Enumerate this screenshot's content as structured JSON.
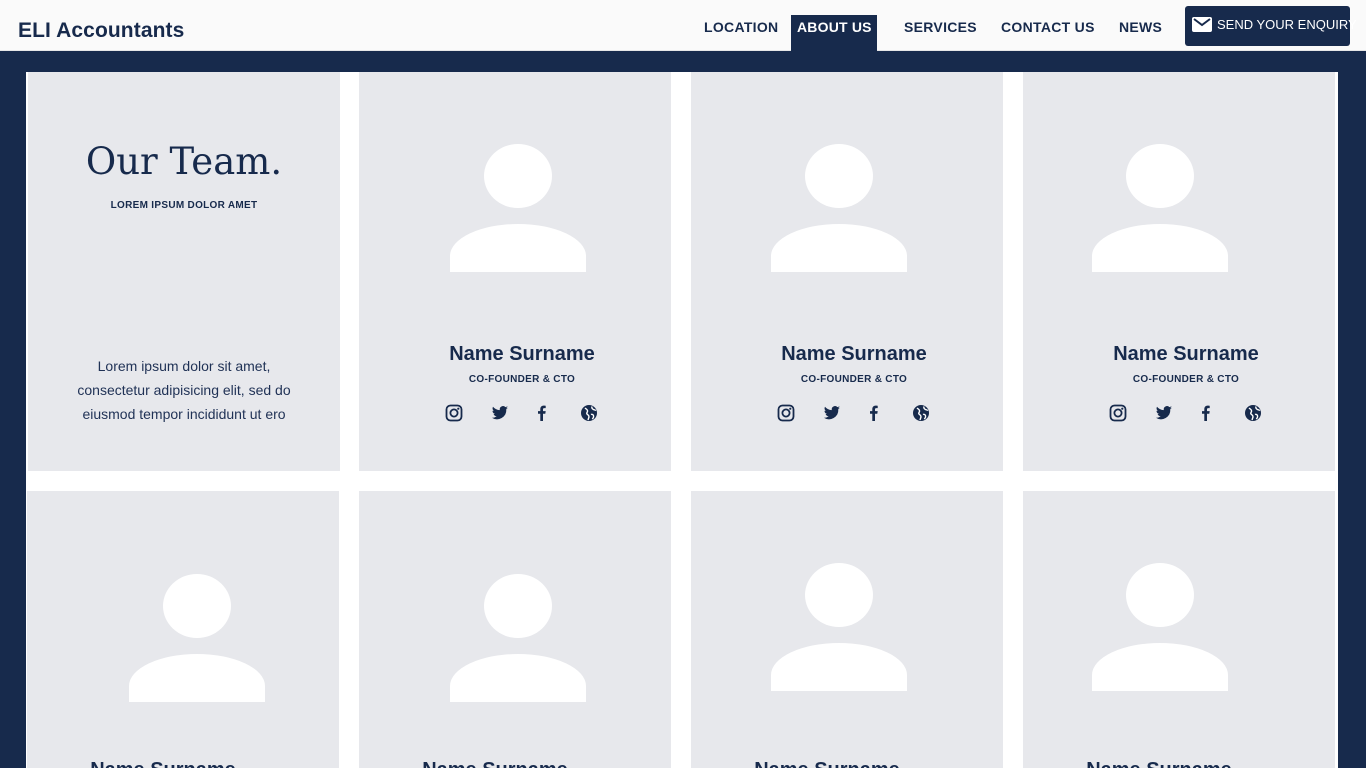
{
  "header": {
    "brand": "ELI Accountants",
    "nav": [
      {
        "label": "LOCATION"
      },
      {
        "label": "ABOUT US"
      },
      {
        "label": "SERVICES"
      },
      {
        "label": "CONTACT US"
      },
      {
        "label": "NEWS"
      }
    ],
    "active_nav": "ABOUT US",
    "enquiry_label": "SEND YOUR ENQUIRY"
  },
  "intro": {
    "title": "Our Team.",
    "subtitle": "LOREM IPSUM DOLOR AMET",
    "text": "Lorem ipsum dolor sit amet, consectetur adipisicing elit, sed do eiusmod tempor incididunt ut ero"
  },
  "members": [
    {
      "name": "Name Surname",
      "role": "CO-FOUNDER & CTO"
    },
    {
      "name": "Name Surname",
      "role": "CO-FOUNDER & CTO"
    },
    {
      "name": "Name Surname",
      "role": "CO-FOUNDER & CTO"
    },
    {
      "name": "Name Surname"
    },
    {
      "name": "Name Surname"
    },
    {
      "name": "Name Surname"
    },
    {
      "name": "Name Surname"
    }
  ],
  "social_icons": [
    "instagram-icon",
    "twitter-icon",
    "facebook-icon",
    "globe-icon"
  ],
  "colors": {
    "navy": "#172a4c",
    "card": "#e7e8ec",
    "header": "#fafafa"
  }
}
